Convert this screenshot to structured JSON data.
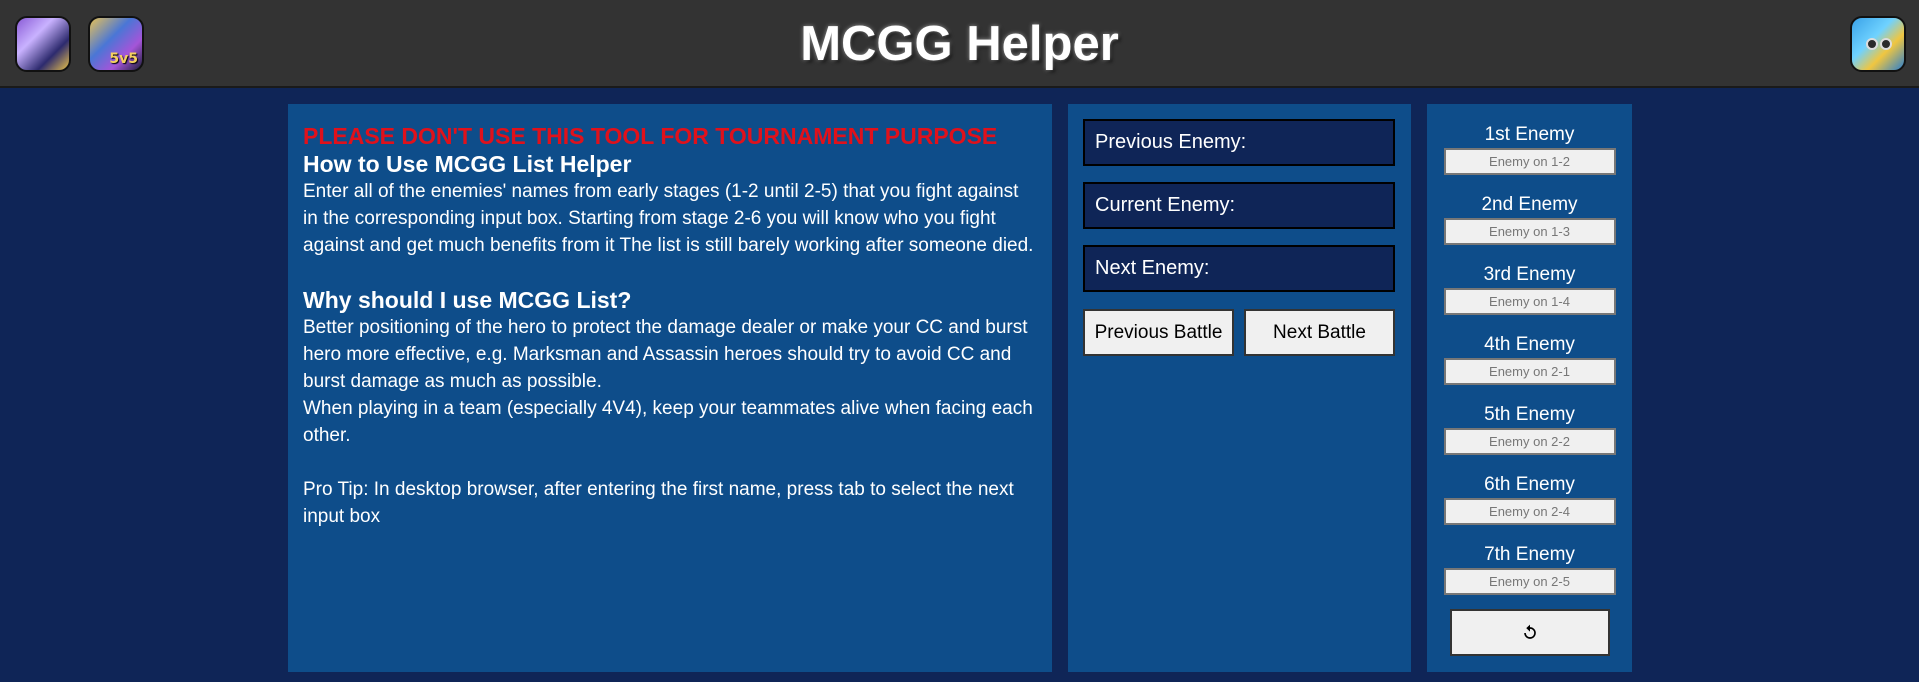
{
  "header": {
    "title": "MCGG Helper",
    "left_icons": [
      "hero-portrait-icon",
      "5v5-game-icon"
    ],
    "left_icon_badge": "5v5",
    "right_icon": "mascot-icon"
  },
  "info": {
    "warning": "PLEASE DON'T USE THIS TOOL FOR TOURNAMENT PURPOSE",
    "how_title": "How to Use MCGG List Helper",
    "how_text": "Enter all of the enemies' names from early stages (1-2 until 2-5) that you fight against in the corresponding input box. Starting from stage 2-6 you will know who you fight against and get much benefits from it The list is still barely working after someone died.",
    "why_title": "Why should I use MCGG List?",
    "why_text_1": "Better positioning of the hero to protect the damage dealer or make your CC and burst hero more effective, e.g. Marksman and Assassin heroes should try to avoid CC and burst damage as much as possible.",
    "why_text_2": "When playing in a team (especially 4V4), keep your teammates alive when facing each other.",
    "pro_tip": "Pro Tip: In desktop browser, after entering the first name, press tab to select the next input box"
  },
  "controls": {
    "previous_enemy": "Previous Enemy:",
    "current_enemy": "Current Enemy:",
    "next_enemy": "Next Enemy:",
    "previous_battle_label": "Previous Battle",
    "next_battle_label": "Next Battle"
  },
  "enemies": [
    {
      "label": "1st Enemy",
      "placeholder": "Enemy on 1-2"
    },
    {
      "label": "2nd Enemy",
      "placeholder": "Enemy on 1-3"
    },
    {
      "label": "3rd Enemy",
      "placeholder": "Enemy on 1-4"
    },
    {
      "label": "4th Enemy",
      "placeholder": "Enemy on 2-1"
    },
    {
      "label": "5th Enemy",
      "placeholder": "Enemy on 2-2"
    },
    {
      "label": "6th Enemy",
      "placeholder": "Enemy on 2-4"
    },
    {
      "label": "7th Enemy",
      "placeholder": "Enemy on 2-5"
    }
  ],
  "reset_icon": "reset-icon",
  "colors": {
    "page_bg": "#0f2557",
    "panel_bg": "#0e4d8a",
    "header_bg": "#333333",
    "warning": "#e0111b"
  }
}
